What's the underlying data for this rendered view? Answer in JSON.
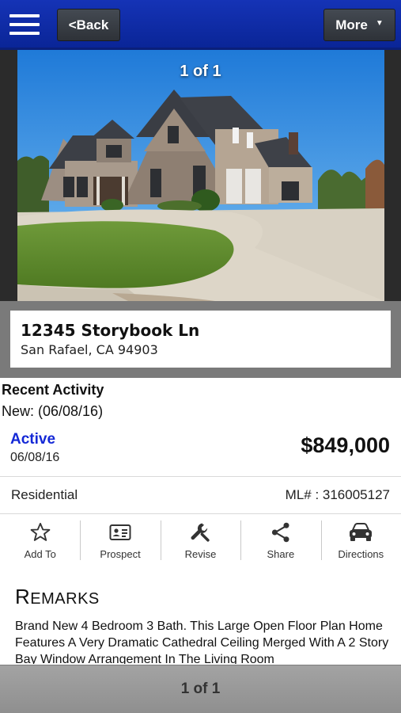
{
  "header": {
    "back_label": "<Back",
    "more_label": "More",
    "more_caret": "▼"
  },
  "photo": {
    "counter": "1 of 1"
  },
  "listing": {
    "street": "12345 Storybook Ln",
    "city_state_zip": "San Rafael, CA 94903",
    "recent_activity_title": "Recent Activity",
    "recent_activity_item": "New: (06/08/16)",
    "status": "Active",
    "status_date": "06/08/16",
    "price": "$849,000",
    "type": "Residential",
    "mls": "ML# : 316005127"
  },
  "actions": [
    {
      "label": "Add To",
      "icon": "star-icon"
    },
    {
      "label": "Prospect",
      "icon": "contact-card-icon"
    },
    {
      "label": "Revise",
      "icon": "wrench-icon"
    },
    {
      "label": "Share",
      "icon": "share-icon"
    },
    {
      "label": "Directions",
      "icon": "car-icon"
    }
  ],
  "remarks": {
    "title_first": "R",
    "title_rest": "EMARKS",
    "text": "Brand New 4 Bedroom 3 Bath. This Large Open Floor Plan Home Features A Very Dramatic Cathedral Ceiling Merged With A 2 Story Bay Window Arrangement In The Living Room"
  },
  "footer": {
    "pager": "1 of 1"
  },
  "colors": {
    "header_blue": "#1533b6",
    "status_blue": "#1428d6",
    "footer_gray": "#9a9a9a"
  }
}
